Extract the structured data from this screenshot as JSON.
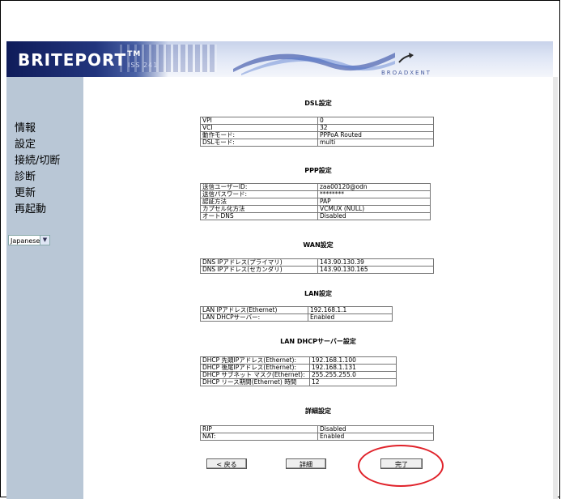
{
  "header": {
    "logo_text": "BRITEPORT",
    "logo_tm": "TM",
    "sub_logo": "ISS 241",
    "brand_right": "BROADXENT"
  },
  "sidebar": {
    "items": [
      {
        "label": "情報"
      },
      {
        "label": "設定"
      },
      {
        "label": "接続/切断"
      },
      {
        "label": "診断"
      },
      {
        "label": "更新"
      },
      {
        "label": "再起動"
      }
    ],
    "language": {
      "selected": "Japanese"
    }
  },
  "sections": {
    "dsl": {
      "title": "DSL設定",
      "rows": [
        {
          "label": "VPI",
          "value": "0"
        },
        {
          "label": "VCI",
          "value": "32"
        },
        {
          "label": "動作モード:",
          "value": "PPPoA Routed"
        },
        {
          "label": "DSLモード:",
          "value": "multi"
        }
      ]
    },
    "ppp": {
      "title": "PPP設定",
      "rows": [
        {
          "label": "送信ユーザーID:",
          "value": "zaa00120@odn"
        },
        {
          "label": "送信パスワード:",
          "value": "********"
        },
        {
          "label": "認証方法",
          "value": "PAP"
        },
        {
          "label": "カプセル化方法",
          "value": "VCMUX (NULL)"
        },
        {
          "label": "オートDNS",
          "value": "Disabled"
        }
      ]
    },
    "wan": {
      "title": "WAN設定",
      "rows": [
        {
          "label": "DNS IPアドレス(プライマリ)",
          "value": "143.90.130.39"
        },
        {
          "label": "DNS IPアドレス(セカンダリ)",
          "value": "143.90.130.165"
        }
      ]
    },
    "lan": {
      "title": "LAN設定",
      "rows": [
        {
          "label": "LAN IPアドレス(Ethernet)",
          "value": "192.168.1.1"
        },
        {
          "label": "LAN DHCPサーバー:",
          "value": "Enabled"
        }
      ]
    },
    "lan_dhcp": {
      "title": "LAN DHCPサーバー設定",
      "rows": [
        {
          "label": "DHCP 先頭IPアドレス(Ethernet):",
          "value": "192.168.1.100"
        },
        {
          "label": "DHCP 後尾IPアドレス(Ethernet):",
          "value": "192.168.1.131"
        },
        {
          "label": "DHCP サブネット マスク(Ethernet):",
          "value": "255.255.255.0"
        },
        {
          "label": "DHCP リース期間(Ethernet) 時間",
          "value": "12"
        }
      ]
    },
    "detail": {
      "title": "詳細設定",
      "rows": [
        {
          "label": "RIP",
          "value": "Disabled"
        },
        {
          "label": "NAT:",
          "value": "Enabled"
        }
      ]
    }
  },
  "buttons": {
    "back": "< 戻る",
    "details": "詳細",
    "finish": "完了"
  },
  "colors": {
    "sidebar_bg": "#b9c7d6",
    "highlight_circle": "#e0222a"
  }
}
